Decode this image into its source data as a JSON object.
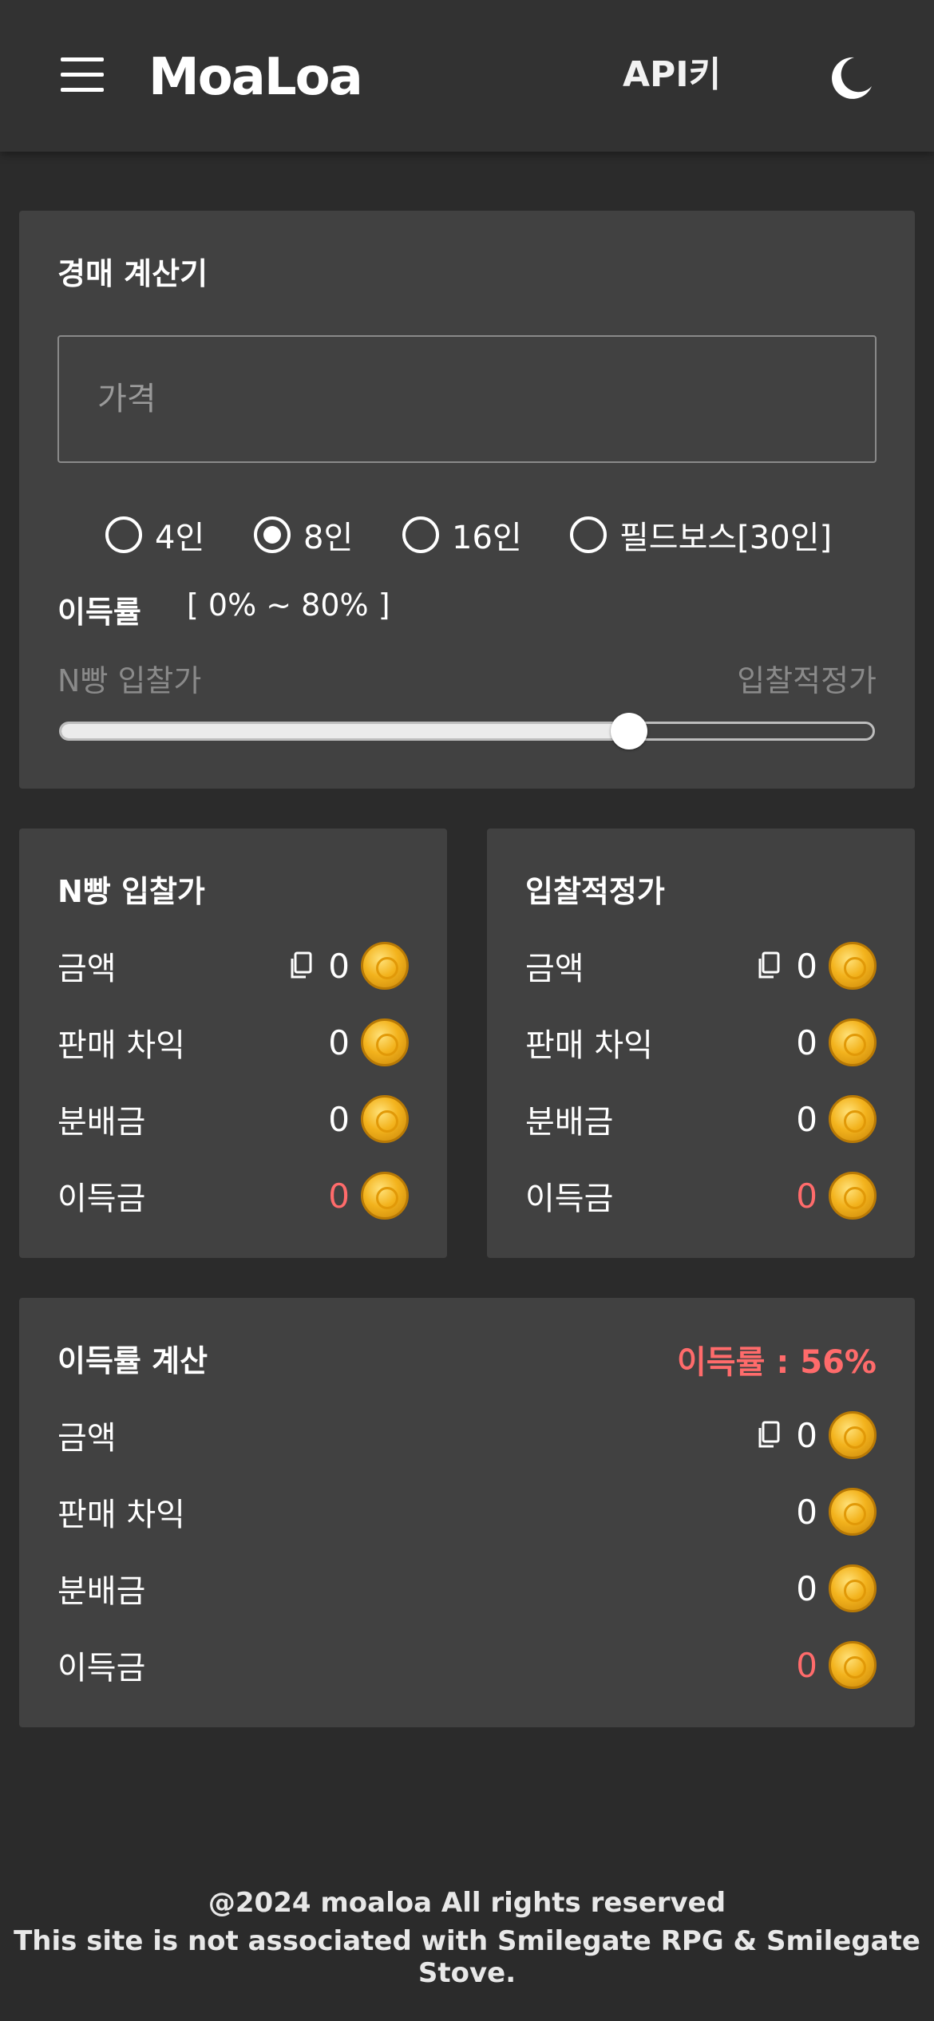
{
  "header": {
    "logo": "MoaLoa",
    "api_key_label": "API키"
  },
  "auction_calc": {
    "title": "경매 계산기",
    "price_placeholder": "가격",
    "options": [
      {
        "label": "4인",
        "checked": false
      },
      {
        "label": "8인",
        "checked": true
      },
      {
        "label": "16인",
        "checked": false
      },
      {
        "label": "필드보스[30인]",
        "checked": false
      }
    ],
    "profit_label": "이득률",
    "profit_range": "[ 0% ~ 80% ]",
    "slider_left_label": "N빵 입찰가",
    "slider_right_label": "입찰적정가",
    "slider_value_fraction": 0.7
  },
  "n_bid": {
    "title": "N빵 입찰가",
    "rows": [
      {
        "label": "금액",
        "value": "0"
      },
      {
        "label": "판매 차익",
        "value": "0"
      },
      {
        "label": "분배금",
        "value": "0"
      },
      {
        "label": "이득금",
        "value": "0"
      }
    ]
  },
  "fair_bid": {
    "title": "입찰적정가",
    "rows": [
      {
        "label": "금액",
        "value": "0"
      },
      {
        "label": "판매 차익",
        "value": "0"
      },
      {
        "label": "분배금",
        "value": "0"
      },
      {
        "label": "이득금",
        "value": "0"
      }
    ]
  },
  "profit_calc": {
    "title": "이득률 계산",
    "rate": "이득률 : 56%",
    "rows": [
      {
        "label": "금액",
        "value": "0"
      },
      {
        "label": "판매 차익",
        "value": "0"
      },
      {
        "label": "분배금",
        "value": "0"
      },
      {
        "label": "이득금",
        "value": "0"
      }
    ]
  },
  "footer": {
    "line1": "@2024 moaloa All rights reserved",
    "line2": "This site is not associated with Smilegate RPG & Smilegate Stove."
  },
  "colors": {
    "background": "#2b2b2b",
    "card": "#414141",
    "header": "#323232",
    "negative": "#ff6b6b"
  },
  "icons": [
    "menu-icon",
    "moon-icon",
    "copy-icon",
    "gold-coin-icon"
  ]
}
